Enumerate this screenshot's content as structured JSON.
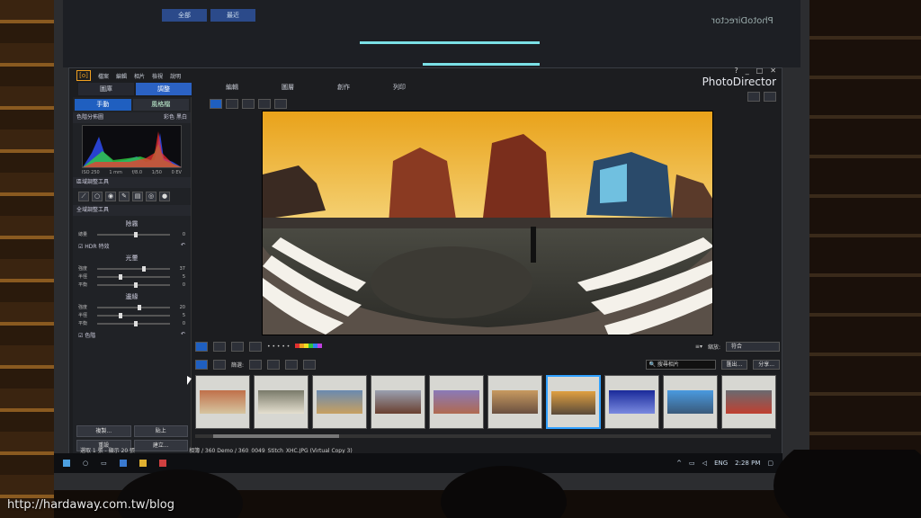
{
  "ghost_ui": {
    "title": "PhotoDirector",
    "tabs": [
      "全部",
      "最近"
    ]
  },
  "app": {
    "name": "PhotoDirector",
    "logo": "[o]",
    "menu": [
      "檔案",
      "編輯",
      "相片",
      "檢視",
      "說明"
    ],
    "win_controls": [
      "?",
      "_",
      "□",
      "✕"
    ],
    "modules": [
      {
        "label": "圖庫",
        "active": false
      },
      {
        "label": "調整",
        "active": true
      }
    ],
    "top_tabs": [
      "編輯",
      "圖層",
      "創作",
      "列印"
    ]
  },
  "left_panel": {
    "subtabs": [
      {
        "label": "手動",
        "active": true
      },
      {
        "label": "風格檔",
        "active": false
      }
    ],
    "histogram_section": {
      "title": "色階分佈圖",
      "color": "彩色",
      "bw": "黑白"
    },
    "histogram_caption": [
      "ISO 250",
      "1 mm",
      "f/8.0",
      "1/50",
      "0 EV"
    ],
    "local_tools_title": "區域調整工具",
    "global_tools_title": "全域調整工具",
    "dehaze": {
      "title": "除霧",
      "rows": [
        {
          "label": "總量",
          "value": "0",
          "pos": 50
        }
      ]
    },
    "hdr": {
      "title": "HDR 特效",
      "glow": {
        "title": "光暈",
        "rows": [
          {
            "label": "強度",
            "value": "37",
            "pos": 62
          },
          {
            "label": "半徑",
            "value": "5",
            "pos": 30
          },
          {
            "label": "平衡",
            "value": "0",
            "pos": 50
          }
        ]
      },
      "edge": {
        "title": "邊緣",
        "rows": [
          {
            "label": "強度",
            "value": "20",
            "pos": 55
          },
          {
            "label": "半徑",
            "value": "5",
            "pos": 30
          },
          {
            "label": "平衡",
            "value": "0",
            "pos": 50
          }
        ]
      }
    },
    "tone_section": "色階",
    "buttons": [
      "複製...",
      "貼上",
      "重設",
      "建立..."
    ]
  },
  "filmstrip_toolbar": {
    "filter_label": "篩選:",
    "search_placeholder": "搜尋相片",
    "export_label": "匯出...",
    "share_label": "分享...",
    "zoom_label": "縮放:",
    "zoom_value": "符合",
    "colors": [
      "#e03030",
      "#f0a020",
      "#f0e020",
      "#30c040",
      "#3080f0",
      "#c040e0"
    ]
  },
  "filmstrip": {
    "thumbs": [
      {
        "selected": false,
        "colors": [
          "#c0704a",
          "#d6c5a0"
        ]
      },
      {
        "selected": false,
        "colors": [
          "#7a7a6a",
          "#e5e0d0"
        ]
      },
      {
        "selected": false,
        "colors": [
          "#6a8ab0",
          "#c8a060"
        ]
      },
      {
        "selected": false,
        "colors": [
          "#9aa0b0",
          "#6a4030"
        ]
      },
      {
        "selected": false,
        "colors": [
          "#8a7ab8",
          "#b06a50"
        ]
      },
      {
        "selected": false,
        "colors": [
          "#c89a60",
          "#6a5040"
        ]
      },
      {
        "selected": true,
        "colors": [
          "#e0a040",
          "#5a4a3a"
        ]
      },
      {
        "selected": false,
        "colors": [
          "#1a2a9a",
          "#7a8ae0"
        ]
      },
      {
        "selected": false,
        "colors": [
          "#4a9ae0",
          "#3a5a7a"
        ]
      },
      {
        "selected": false,
        "colors": [
          "#6a6a70",
          "#c04030"
        ]
      },
      {
        "selected": false,
        "colors": [
          "#c06040",
          "#e8d0b0"
        ]
      }
    ]
  },
  "statusbar": {
    "selection": "選取 1 張 - 顯示 20 張",
    "path": "相簿 / 360 Demo / 360_0049_Stitch_XHC.JPG (Virtual Copy 3)"
  },
  "taskbar": {
    "lang": "ENG",
    "time": "2:28 PM"
  },
  "watermark": "http://hardaway.com.tw/blog"
}
